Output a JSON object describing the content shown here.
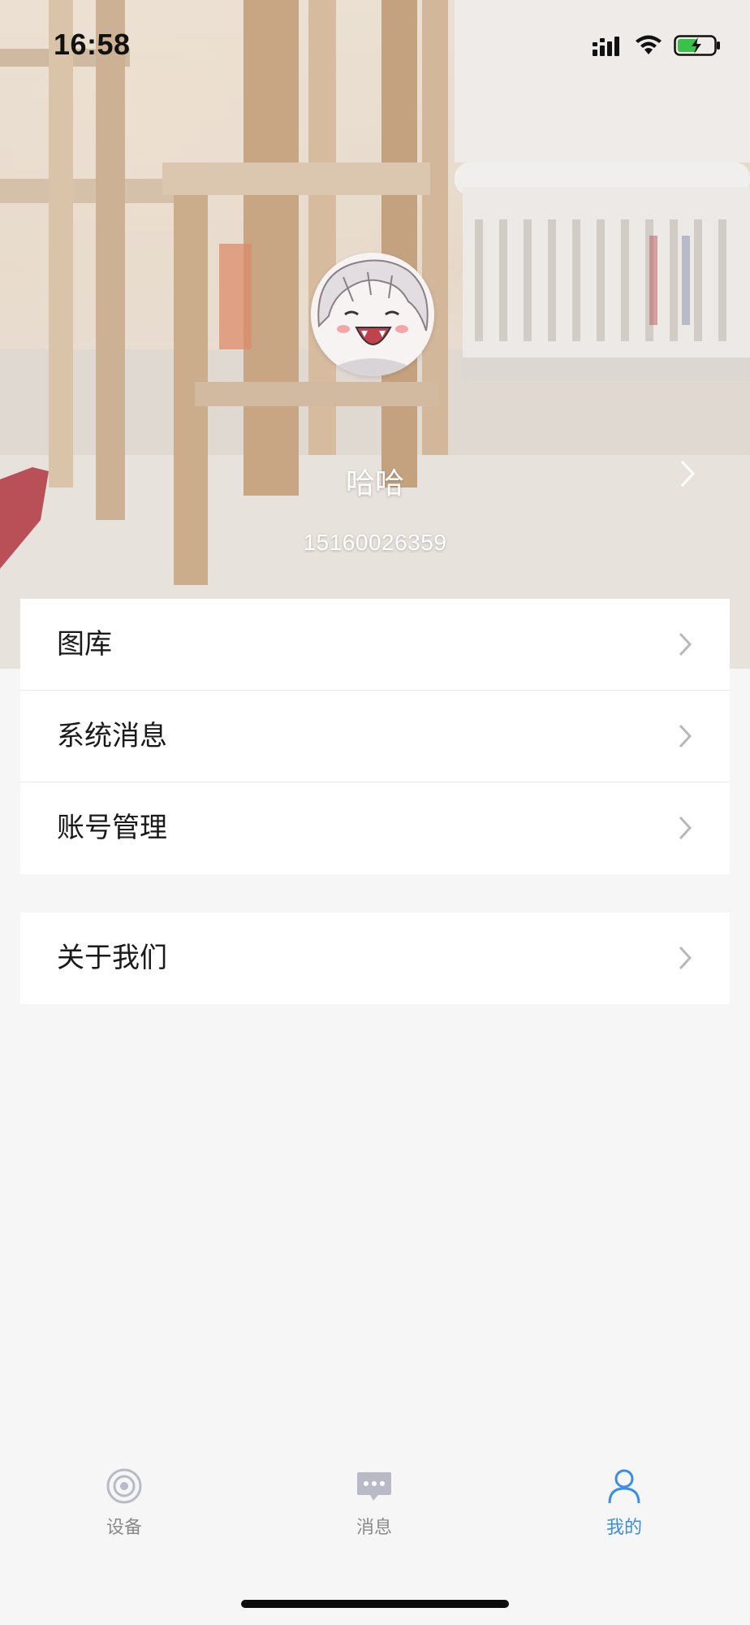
{
  "status_bar": {
    "time": "16:58"
  },
  "profile": {
    "name": "哈哈",
    "phone": "15160026359"
  },
  "menu": {
    "group1": [
      {
        "label": "图库"
      },
      {
        "label": "系统消息"
      },
      {
        "label": "账号管理"
      }
    ],
    "group2": [
      {
        "label": "关于我们"
      }
    ]
  },
  "tabbar": {
    "tabs": [
      {
        "label": "设备",
        "icon": "device-icon"
      },
      {
        "label": "消息",
        "icon": "message-icon"
      },
      {
        "label": "我的",
        "icon": "person-icon"
      }
    ],
    "active_index": 2,
    "active_color": "#3a8ee6",
    "inactive_color": "#8a8a8a"
  }
}
